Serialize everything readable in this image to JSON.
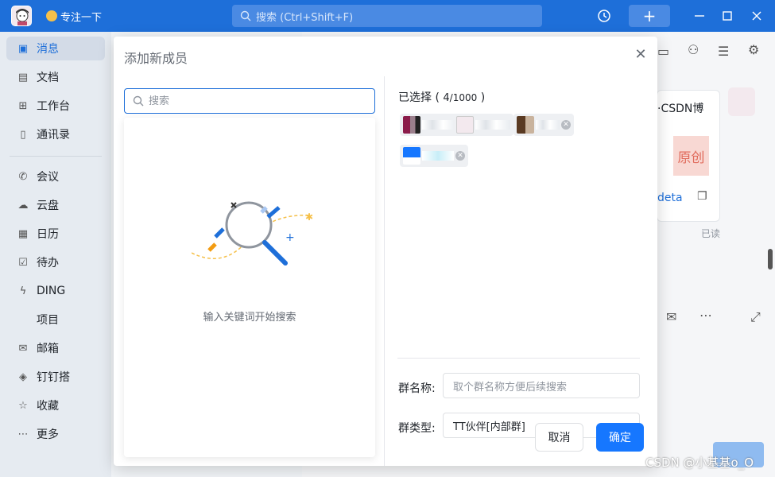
{
  "titlebar": {
    "focus_label": "专注一下",
    "search_placeholder": "搜索 (Ctrl+Shift+F)",
    "plus_label": "+"
  },
  "sidebar": {
    "items": [
      {
        "label": "消息",
        "icon": "chat-icon",
        "active": true
      },
      {
        "label": "文档",
        "icon": "doc-icon"
      },
      {
        "label": "工作台",
        "icon": "grid-icon"
      },
      {
        "label": "通讯录",
        "icon": "contacts-icon"
      },
      {
        "label": "会议",
        "icon": "phone-icon"
      },
      {
        "label": "云盘",
        "icon": "cloud-icon"
      },
      {
        "label": "日历",
        "icon": "calendar-icon"
      },
      {
        "label": "待办",
        "icon": "todo-icon"
      },
      {
        "label": "DING",
        "icon": "ding-icon"
      },
      {
        "label": "项目",
        "icon": ""
      },
      {
        "label": "邮箱",
        "icon": "mail-icon"
      },
      {
        "label": "钉钉搭",
        "icon": "builder-icon"
      },
      {
        "label": "收藏",
        "icon": "star-icon"
      },
      {
        "label": "更多",
        "icon": "more-icon"
      }
    ]
  },
  "background": {
    "card_text": "·CSDN博",
    "card_badge": "原创",
    "card_link": "deta",
    "read_status": "已读"
  },
  "dialog": {
    "title": "添加新成员",
    "search_placeholder": "搜索",
    "empty_text": "输入关键词开始搜索",
    "selected_label": "已选择",
    "selected_count": "4",
    "selected_max": "/1000",
    "group_name_label": "群名称:",
    "group_name_placeholder": "取个群名称方便后续搜索",
    "group_type_label": "群类型:",
    "group_type_value": "TT伙伴[内部群]",
    "cancel_label": "取消",
    "ok_label": "确定"
  },
  "watermark": "CSDN @小基基o_O",
  "colors": {
    "accent": "#1677ff",
    "titlebar": "#1e6fd9"
  }
}
